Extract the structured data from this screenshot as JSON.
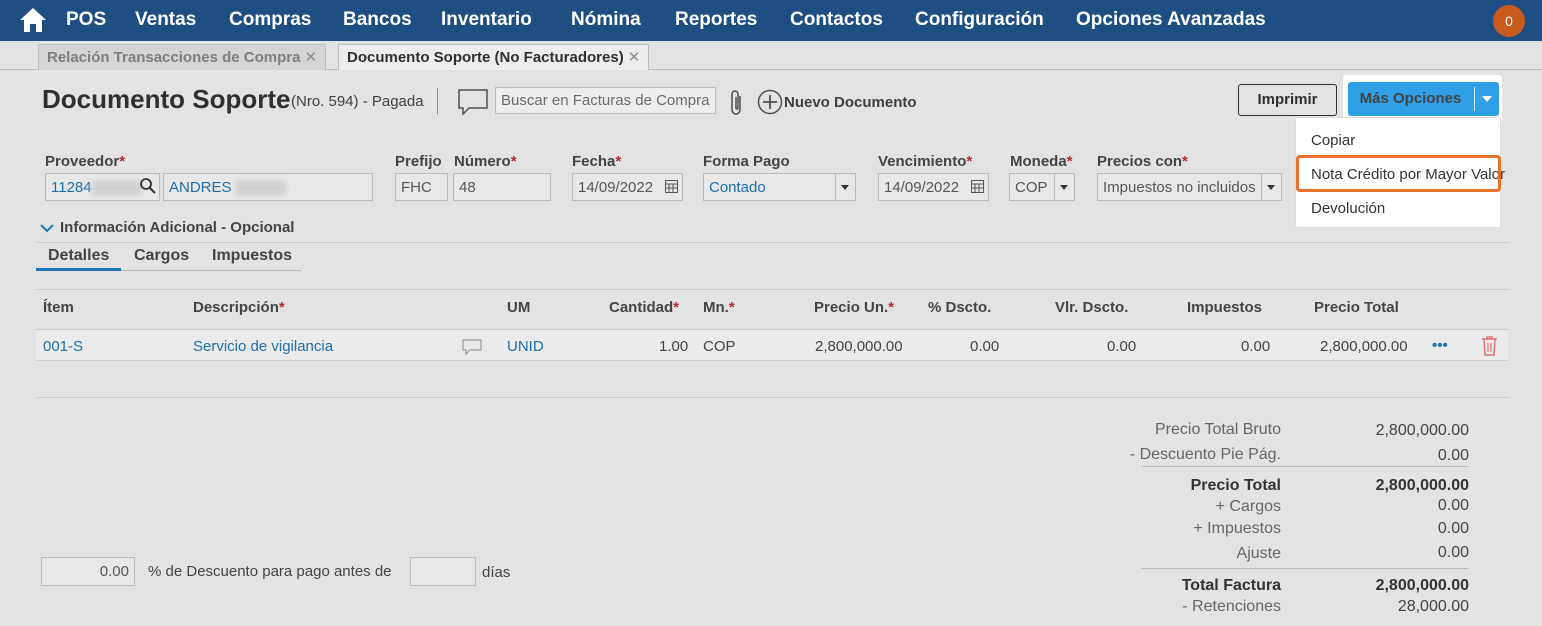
{
  "nav": {
    "items": [
      "POS",
      "Ventas",
      "Compras",
      "Bancos",
      "Inventario",
      "Nómina",
      "Reportes",
      "Contactos",
      "Configuración",
      "Opciones Avanzadas"
    ],
    "notification_count": "0",
    "brand_color": "#1f4f82"
  },
  "tabs": [
    {
      "label": "Relación Transacciones de Compra",
      "close": "✕"
    },
    {
      "label": "Documento Soporte (No Facturadores)",
      "close": "✕"
    }
  ],
  "header": {
    "title": "Documento Soporte",
    "subtitle": "(Nro. 594) - Pagada",
    "search_placeholder": "Buscar en Facturas de Compra",
    "new_doc": "Nuevo Documento",
    "print": "Imprimir",
    "more_options": "Más Opciones"
  },
  "dropdown": {
    "items": [
      "Copiar",
      "Nota Crédito por Mayor Valor",
      "Devolución"
    ],
    "highlight_color": "#e8722a"
  },
  "form": {
    "proveedor_label": "Proveedor",
    "proveedor_id": "11284",
    "proveedor_name": "ANDRES",
    "prefijo_label": "Prefijo",
    "prefijo": "FHC",
    "numero_label": "Número",
    "numero": "48",
    "fecha_label": "Fecha",
    "fecha": "14/09/2022",
    "forma_pago_label": "Forma Pago",
    "forma_pago": "Contado",
    "vencimiento_label": "Vencimiento",
    "vencimiento": "14/09/2022",
    "moneda_label": "Moneda",
    "moneda": "COP",
    "precios_label": "Precios con",
    "precios": "Impuestos no incluidos",
    "required_mark": "*"
  },
  "info_adicional": "Información Adicional - Opcional",
  "subtabs": [
    "Detalles",
    "Cargos",
    "Impuestos"
  ],
  "table": {
    "headers": [
      "Ítem",
      "Descripción",
      "UM",
      "Cantidad",
      "Mn.",
      "Precio Un.",
      "% Dscto.",
      "Vlr. Dscto.",
      "Impuestos",
      "Precio Total"
    ],
    "row": {
      "item": "001-S",
      "descripcion": "Servicio de vigilancia",
      "um": "UNID",
      "cantidad": "1.00",
      "mn": "COP",
      "precio_un": "2,800,000.00",
      "dscto_pct": "0.00",
      "vlr_dscto": "0.00",
      "impuestos": "0.00",
      "precio_total": "2,800,000.00",
      "more": "•••"
    }
  },
  "discount": {
    "value": "0.00",
    "label": "% de Descuento para pago antes de",
    "days_label": "días"
  },
  "totals": {
    "bruto_label": "Precio Total Bruto",
    "bruto": "2,800,000.00",
    "desc_label": "- Descuento Pie Pág.",
    "desc": "0.00",
    "precio_total_label": "Precio Total",
    "precio_total": "2,800,000.00",
    "cargos_label": "+ Cargos",
    "cargos": "0.00",
    "impuestos_label": "+ Impuestos",
    "impuestos": "0.00",
    "ajuste_label": "Ajuste",
    "ajuste": "0.00",
    "factura_label": "Total Factura",
    "factura": "2,800,000.00",
    "retenciones_label": "- Retenciones",
    "retenciones": "28,000.00"
  }
}
